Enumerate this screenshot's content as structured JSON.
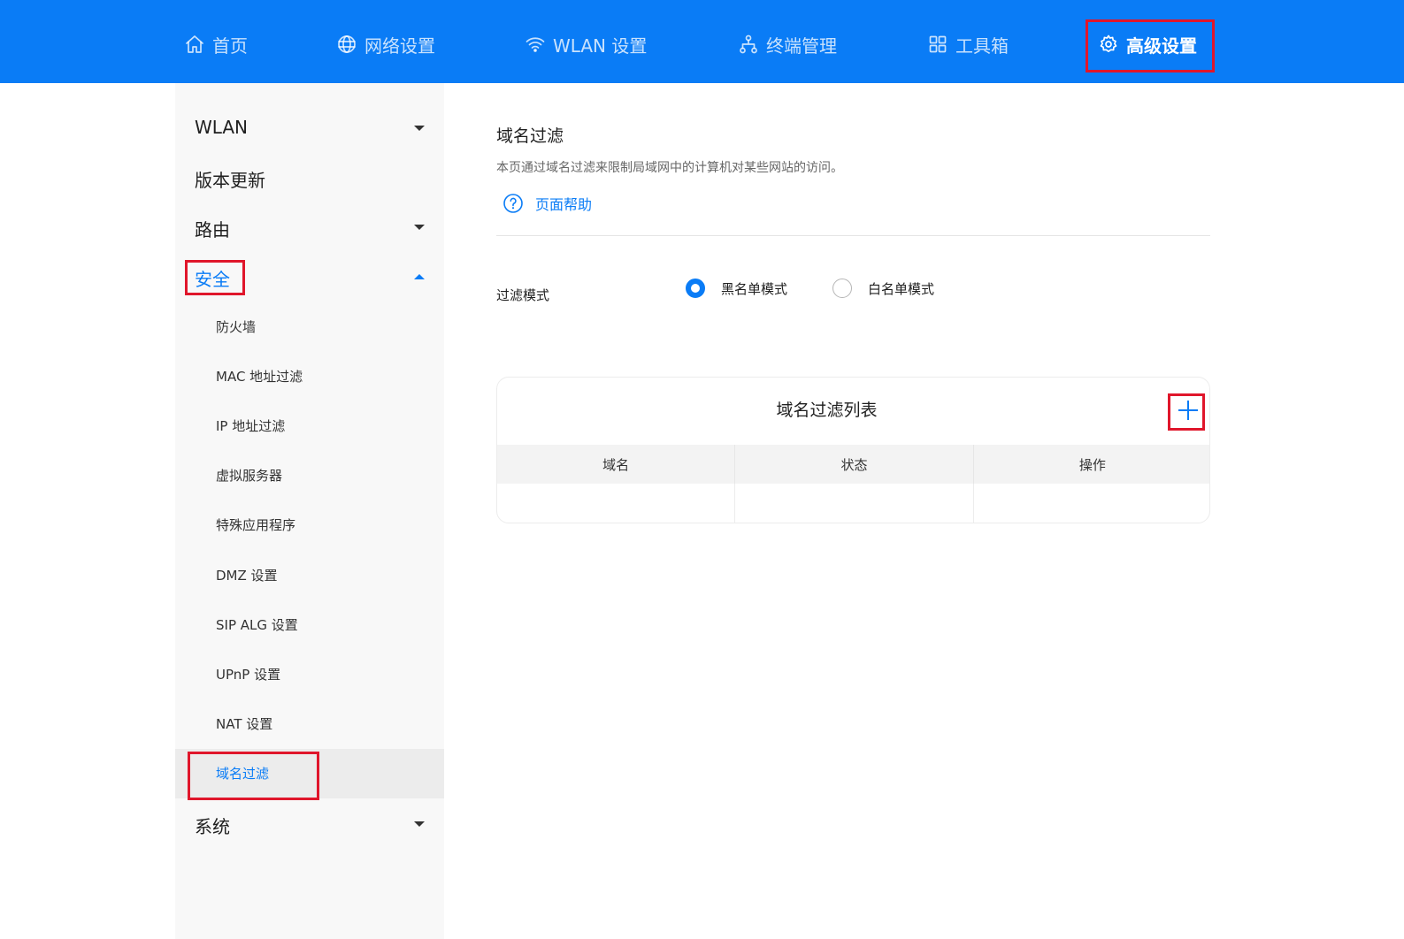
{
  "nav": {
    "items": [
      {
        "label": "首页",
        "icon": "home-icon"
      },
      {
        "label": "网络设置",
        "icon": "globe-icon"
      },
      {
        "label": "WLAN 设置",
        "icon": "wifi-icon"
      },
      {
        "label": "终端管理",
        "icon": "devices-icon"
      },
      {
        "label": "工具箱",
        "icon": "apps-grid-icon"
      },
      {
        "label": "高级设置",
        "icon": "gear-icon"
      }
    ],
    "active_index": 5
  },
  "sidebar": {
    "wlan": "WLAN",
    "version_update": "版本更新",
    "routing": "路由",
    "security": "安全",
    "security_items": [
      "防火墙",
      "MAC 地址过滤",
      "IP 地址过滤",
      "虚拟服务器",
      "特殊应用程序",
      "DMZ 设置",
      "SIP ALG 设置",
      "UPnP 设置",
      "NAT 设置",
      "域名过滤"
    ],
    "system": "系统"
  },
  "main": {
    "title": "域名过滤",
    "description": "本页通过域名过滤来限制局域网中的计算机对某些网站的访问。",
    "help": "页面帮助",
    "filter_mode_label": "过滤模式",
    "radio_options": [
      {
        "label": "黑名单模式",
        "selected": true
      },
      {
        "label": "白名单模式",
        "selected": false
      }
    ]
  },
  "table": {
    "title": "域名过滤列表",
    "columns": [
      "域名",
      "状态",
      "操作"
    ],
    "rows": []
  },
  "colors": {
    "brand": "#0a7cf6",
    "highlight_box": "#e0162b"
  }
}
